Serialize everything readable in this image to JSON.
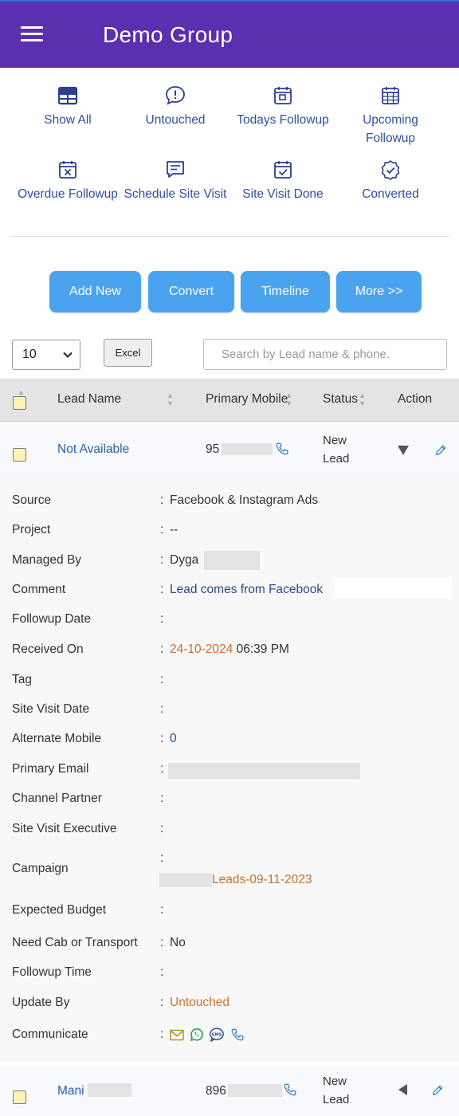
{
  "header": {
    "title": "Demo Group"
  },
  "quick_filters": [
    {
      "label": "Show All",
      "icon": "grid-icon"
    },
    {
      "label": "Untouched",
      "icon": "alert-bubble-icon"
    },
    {
      "label": "Todays Followup",
      "icon": "calendar-day-icon"
    },
    {
      "label": "Upcoming Followup",
      "icon": "calendar-grid-icon"
    },
    {
      "label": "Overdue Followup",
      "icon": "calendar-x-icon"
    },
    {
      "label": "Schedule Site Visit",
      "icon": "message-icon"
    },
    {
      "label": "Site Visit Done",
      "icon": "calendar-check-icon"
    },
    {
      "label": "Converted",
      "icon": "badge-check-icon"
    }
  ],
  "actions": {
    "add_new": "Add New",
    "convert": "Convert",
    "timeline": "Timeline",
    "more": "More >>"
  },
  "controls": {
    "page_size": "10",
    "excel": "Excel",
    "search_placeholder": "Search by Lead name & phone."
  },
  "table": {
    "headers": {
      "lead_name": "Lead Name",
      "primary_mobile": "Primary Mobile",
      "status": "Status",
      "action": "Action"
    },
    "rows": [
      {
        "lead_name": "Not Available",
        "mobile": "95",
        "status_line1": "New",
        "status_line2": "Lead"
      },
      {
        "lead_name": "Mani",
        "mobile": "896",
        "status_line1": "New",
        "status_line2": "Lead"
      }
    ]
  },
  "details": {
    "source": {
      "label": "Source",
      "value": "Facebook & Instagram Ads"
    },
    "project": {
      "label": "Project",
      "value": "--"
    },
    "managed_by": {
      "label": "Managed By",
      "value": "Dyga"
    },
    "comment": {
      "label": "Comment",
      "value": "Lead comes from Facebook"
    },
    "followup_date": {
      "label": "Followup Date",
      "value": ""
    },
    "received_on": {
      "label": "Received On",
      "date": "24-10-2024",
      "time": "06:39 PM"
    },
    "tag": {
      "label": "Tag",
      "value": ""
    },
    "site_visit_date": {
      "label": "Site Visit Date",
      "value": ""
    },
    "alternate_mobile": {
      "label": "Alternate Mobile",
      "value": "0"
    },
    "primary_email": {
      "label": "Primary Email",
      "value": ""
    },
    "channel_partner": {
      "label": "Channel Partner",
      "value": ""
    },
    "site_visit_executive": {
      "label": "Site Visit Executive",
      "value": ""
    },
    "campaign": {
      "label": "Campaign",
      "value": "Leads-09-11-2023"
    },
    "expected_budget": {
      "label": "Expected Budget",
      "value": ""
    },
    "need_cab": {
      "label": "Need Cab or Transport",
      "value": "No"
    },
    "followup_time": {
      "label": "Followup Time",
      "value": ""
    },
    "update_by": {
      "label": "Update By",
      "value": "Untouched"
    },
    "communicate": {
      "label": "Communicate"
    }
  },
  "colors": {
    "header_bg": "#5a2fb0",
    "button_bg": "#4aa3ef",
    "link_blue": "#2c5ea8",
    "orange": "#c9702f"
  }
}
